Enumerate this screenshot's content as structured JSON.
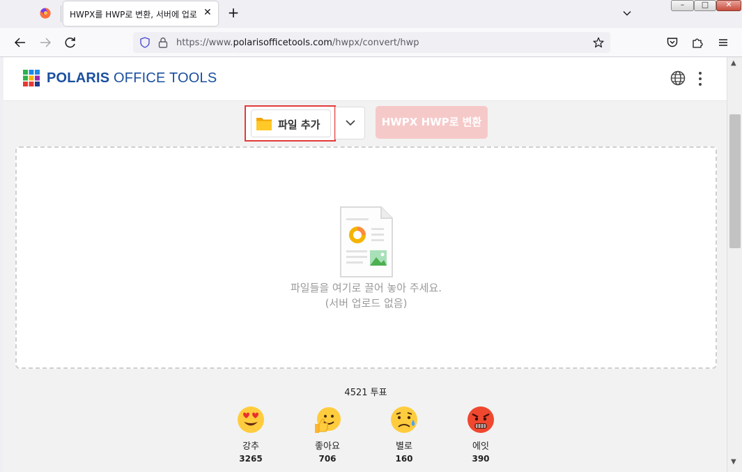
{
  "browser": {
    "tab_title": "HWPX를 HWP로 변환, 서버에 업로",
    "url_prefix": "https://www.",
    "url_domain": "polarisofficetools.com",
    "url_path": "/hwpx/convert/hwp",
    "new_tab": "+",
    "tab_close": "✕"
  },
  "window_controls": {
    "minimize": "–",
    "maximize": "□",
    "close": "✕"
  },
  "site": {
    "logo_bold": "POLARIS",
    "logo_rest": " OFFICE TOOLS"
  },
  "toolbar": {
    "add_file_label": "파일 추가",
    "convert_label": "HWPX HWP로 변환"
  },
  "dropzone": {
    "line1": "파일들을 여기로 끌어 놓아 주세요.",
    "line2": "(서버 업로드 없음)"
  },
  "votes": {
    "count_text": "4521 투표",
    "reactions": [
      {
        "name": "강추",
        "count": "3265",
        "emoji": "heart-eyes-icon"
      },
      {
        "name": "좋아요",
        "count": "706",
        "emoji": "thumbs-up-icon"
      },
      {
        "name": "별로",
        "count": "160",
        "emoji": "sad-sweat-icon"
      },
      {
        "name": "에잇",
        "count": "390",
        "emoji": "angry-icon"
      }
    ]
  },
  "colors": {
    "accent_red": "#e23a3a",
    "convert_disabled": "#f6c9c9",
    "logo_blue": "#1a4fa0"
  }
}
